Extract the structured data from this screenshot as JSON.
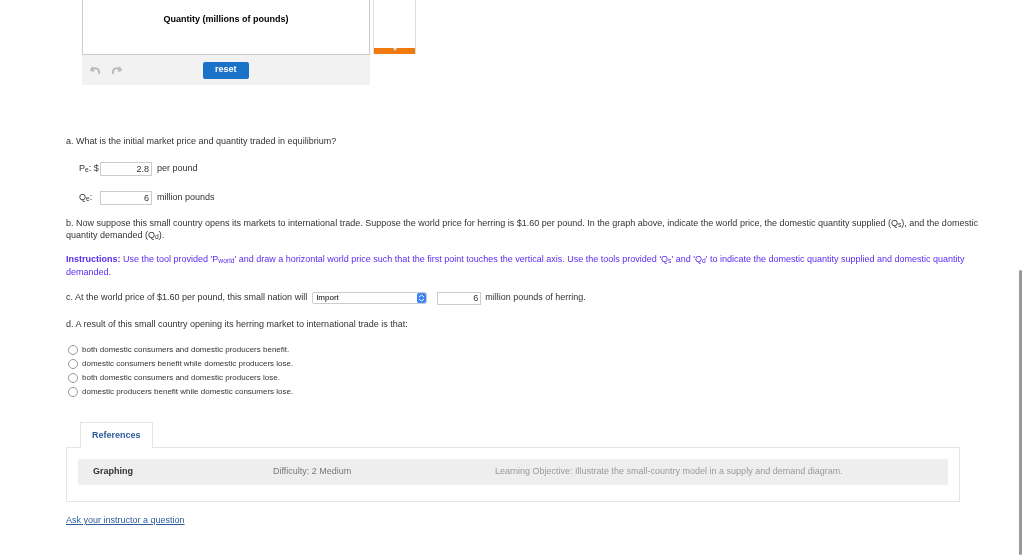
{
  "graph": {
    "axis_label": "Quantity (millions of pounds)",
    "reset_button": "reset"
  },
  "part_a": {
    "question": "a. What is the initial market price and quantity traded in equilibrium?",
    "fields": [
      {
        "label": "P$_{e}$: $",
        "value": "2.8",
        "unit": "per pound"
      },
      {
        "label": "Q$_{e}$:",
        "value": "6",
        "unit": "million pounds"
      }
    ]
  },
  "part_b": {
    "question": "b. Now suppose this small country opens its markets to international trade. Suppose the world price for herring is $1.60 per pound. In the graph above, indicate the world price, the domestic quantity supplied (Q$_{s}$), and the domestic quantity demanded (Q$_{d}$).",
    "instructions": "**Instructions:** Use the tool provided 'P$_{world}$' and draw a horizontal world price such that the first point touches the vertical axis. Use the tools provided 'Q$_{s}$' and 'Q$_{d}$' to indicate the domestic quantity supplied and domestic quantity demanded."
  },
  "part_c": {
    "prefix": "c. At the world price of $1.60 per pound, this small nation will",
    "select_value": "Import",
    "value": "6",
    "suffix": "million pounds of herring."
  },
  "part_d": {
    "question": "d. A result of this small country opening its herring market to international trade is that:",
    "options": [
      {
        "label": "both domestic consumers and domestic producers benefit.",
        "selected": false
      },
      {
        "label": "domestic consumers benefit while domestic producers lose.",
        "selected": false
      },
      {
        "label": "both domestic consumers and domestic producers lose.",
        "selected": false
      },
      {
        "label": "domestic producers benefit while domestic consumers lose.",
        "selected": false
      }
    ]
  },
  "references": {
    "tab": "References",
    "topic": "Graphing",
    "difficulty": "Difficulty: 2 Medium",
    "objective": "Learning Objective: Illustrate the small-country model in a supply and demand diagram."
  },
  "ask_link": "Ask your instructor a question"
}
